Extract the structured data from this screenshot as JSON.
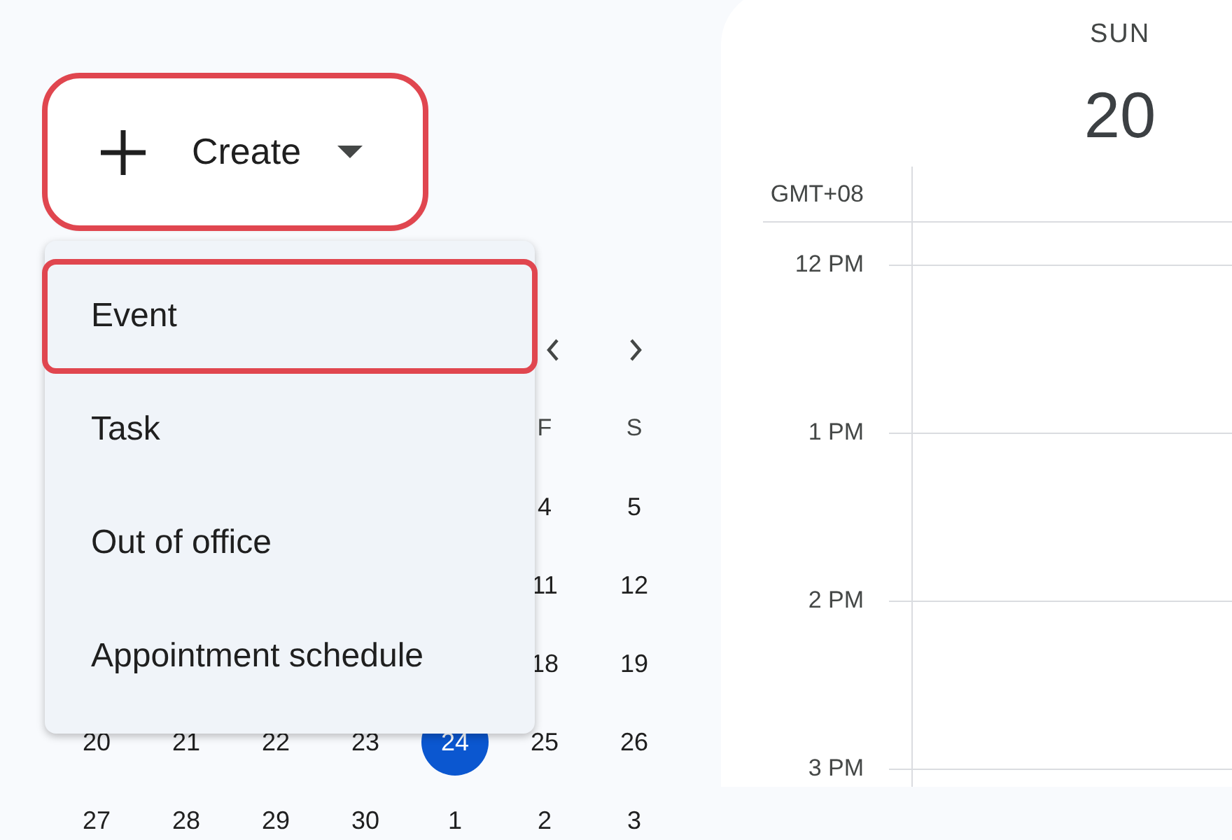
{
  "create_button": {
    "label": "Create",
    "highlighted": true
  },
  "create_menu": {
    "items": [
      {
        "label": "Event",
        "highlighted": true
      },
      {
        "label": "Task",
        "highlighted": false
      },
      {
        "label": "Out of office",
        "highlighted": false
      },
      {
        "label": "Appointment schedule",
        "highlighted": false
      }
    ]
  },
  "mini_calendar": {
    "weekday_header": [
      "F",
      "S"
    ],
    "weeks": [
      {
        "days": [
          {
            "label": "4",
            "selected": false
          },
          {
            "label": "5",
            "selected": false
          }
        ]
      },
      {
        "days": [
          {
            "label": "11",
            "selected": false
          },
          {
            "label": "12",
            "selected": false
          }
        ]
      },
      {
        "days": [
          {
            "label": "18",
            "selected": false
          },
          {
            "label": "19",
            "selected": false
          }
        ]
      },
      {
        "days": [
          {
            "label": "20",
            "selected": false
          },
          {
            "label": "21",
            "selected": false
          },
          {
            "label": "22",
            "selected": false
          },
          {
            "label": "23",
            "selected": false
          },
          {
            "label": "24",
            "selected": true
          },
          {
            "label": "25",
            "selected": false
          },
          {
            "label": "26",
            "selected": false
          }
        ]
      },
      {
        "days": [
          {
            "label": "27",
            "selected": false
          },
          {
            "label": "28",
            "selected": false
          },
          {
            "label": "29",
            "selected": false
          },
          {
            "label": "30",
            "selected": false
          },
          {
            "label": "1",
            "selected": false
          },
          {
            "label": "2",
            "selected": false
          },
          {
            "label": "3",
            "selected": false
          }
        ]
      }
    ]
  },
  "day_view": {
    "weekday": "SUN",
    "date": "20",
    "timezone": "GMT+08",
    "hours": [
      "12 PM",
      "1 PM",
      "2 PM",
      "3 PM"
    ]
  }
}
